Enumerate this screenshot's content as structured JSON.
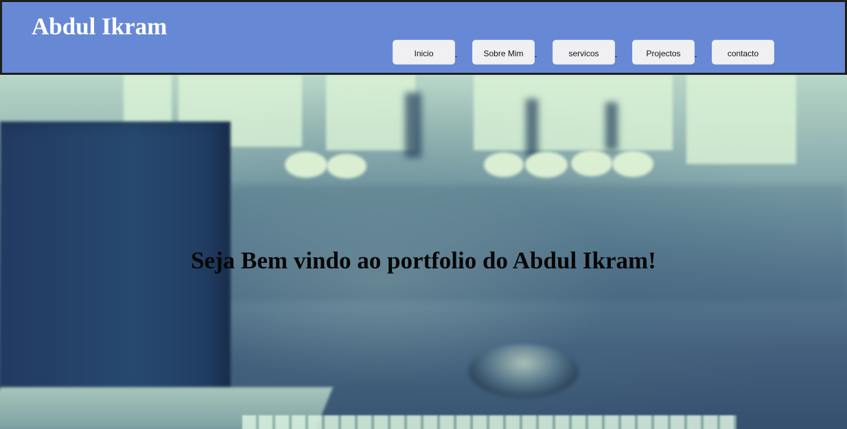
{
  "site": {
    "title": "Abdul Ikram"
  },
  "navigation": {
    "items": [
      {
        "label": "Inicio"
      },
      {
        "label": "Sobre Mim"
      },
      {
        "label": "servicos"
      },
      {
        "label": "Projectos"
      },
      {
        "label": "contacto"
      }
    ]
  },
  "hero": {
    "message": "Seja Bem vindo ao portfolio do Abdul Ikram!"
  },
  "colors": {
    "header_background": "#6789d5",
    "header_border": "#1e1e1e",
    "brand_text": "#ffffff",
    "nav_button": "#f0f0f2",
    "hero_text": "#070707"
  },
  "icons": []
}
